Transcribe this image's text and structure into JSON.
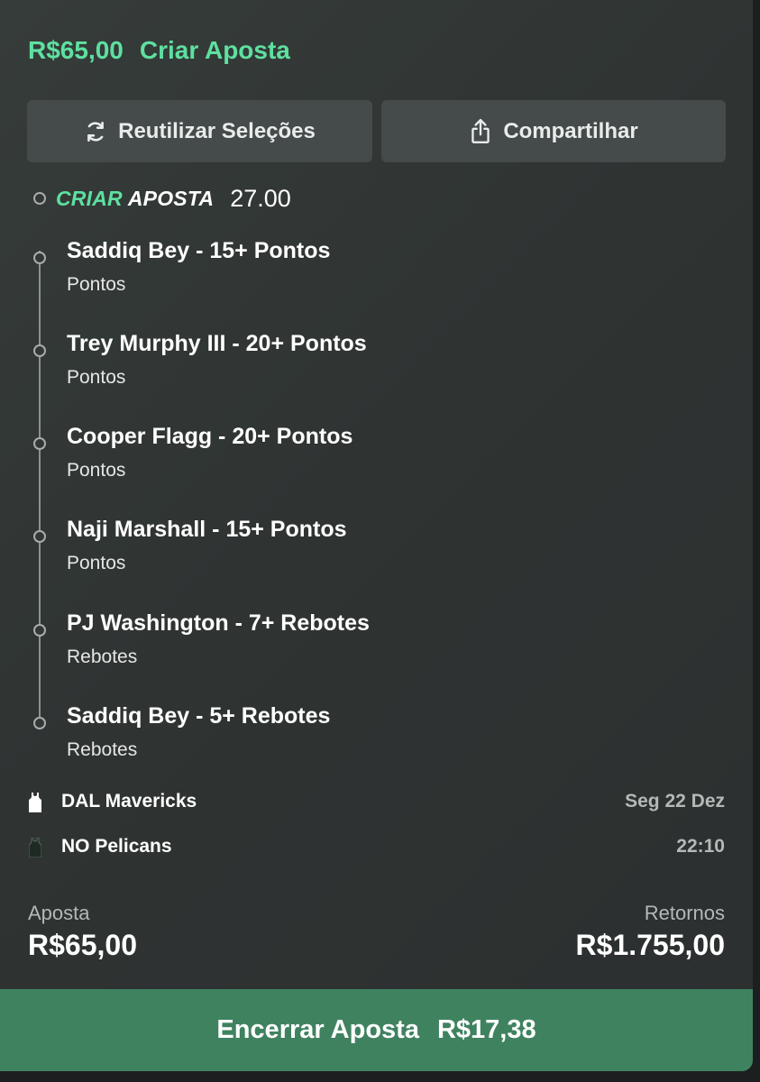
{
  "header": {
    "amount": "R$65,00",
    "title": "Criar Aposta"
  },
  "actions": {
    "reuse_label": "Reutilizar Seleções",
    "share_label": "Compartilhar"
  },
  "betbuilder": {
    "logo_part1": "CRIAR",
    "logo_part2": "APOSTA",
    "odds": "27.00"
  },
  "legs": [
    {
      "title": "Saddiq Bey - 15+ Pontos",
      "market": "Pontos"
    },
    {
      "title": "Trey Murphy III - 20+ Pontos",
      "market": "Pontos"
    },
    {
      "title": "Cooper Flagg - 20+ Pontos",
      "market": "Pontos"
    },
    {
      "title": "Naji Marshall - 15+ Pontos",
      "market": "Pontos"
    },
    {
      "title": "PJ Washington - 7+ Rebotes",
      "market": "Rebotes"
    },
    {
      "title": "Saddiq Bey - 5+ Rebotes",
      "market": "Rebotes"
    }
  ],
  "match": {
    "home": {
      "name": "DAL Mavericks",
      "jersey_color": "#ffffff",
      "jersey_icon": "jersey-icon"
    },
    "away": {
      "name": "NO Pelicans",
      "jersey_color": "#1f2a24",
      "jersey_icon": "jersey-icon"
    },
    "date": "Seg 22 Dez",
    "time": "22:10"
  },
  "summary": {
    "stake_label": "Aposta",
    "stake_value": "R$65,00",
    "returns_label": "Retornos",
    "returns_value": "R$1.755,00"
  },
  "cashout": {
    "label": "Encerrar Aposta",
    "value": "R$17,38"
  },
  "colors": {
    "accent": "#5ee0a0",
    "cashout_bg": "#3f8260",
    "button_bg": "#454b4a"
  }
}
